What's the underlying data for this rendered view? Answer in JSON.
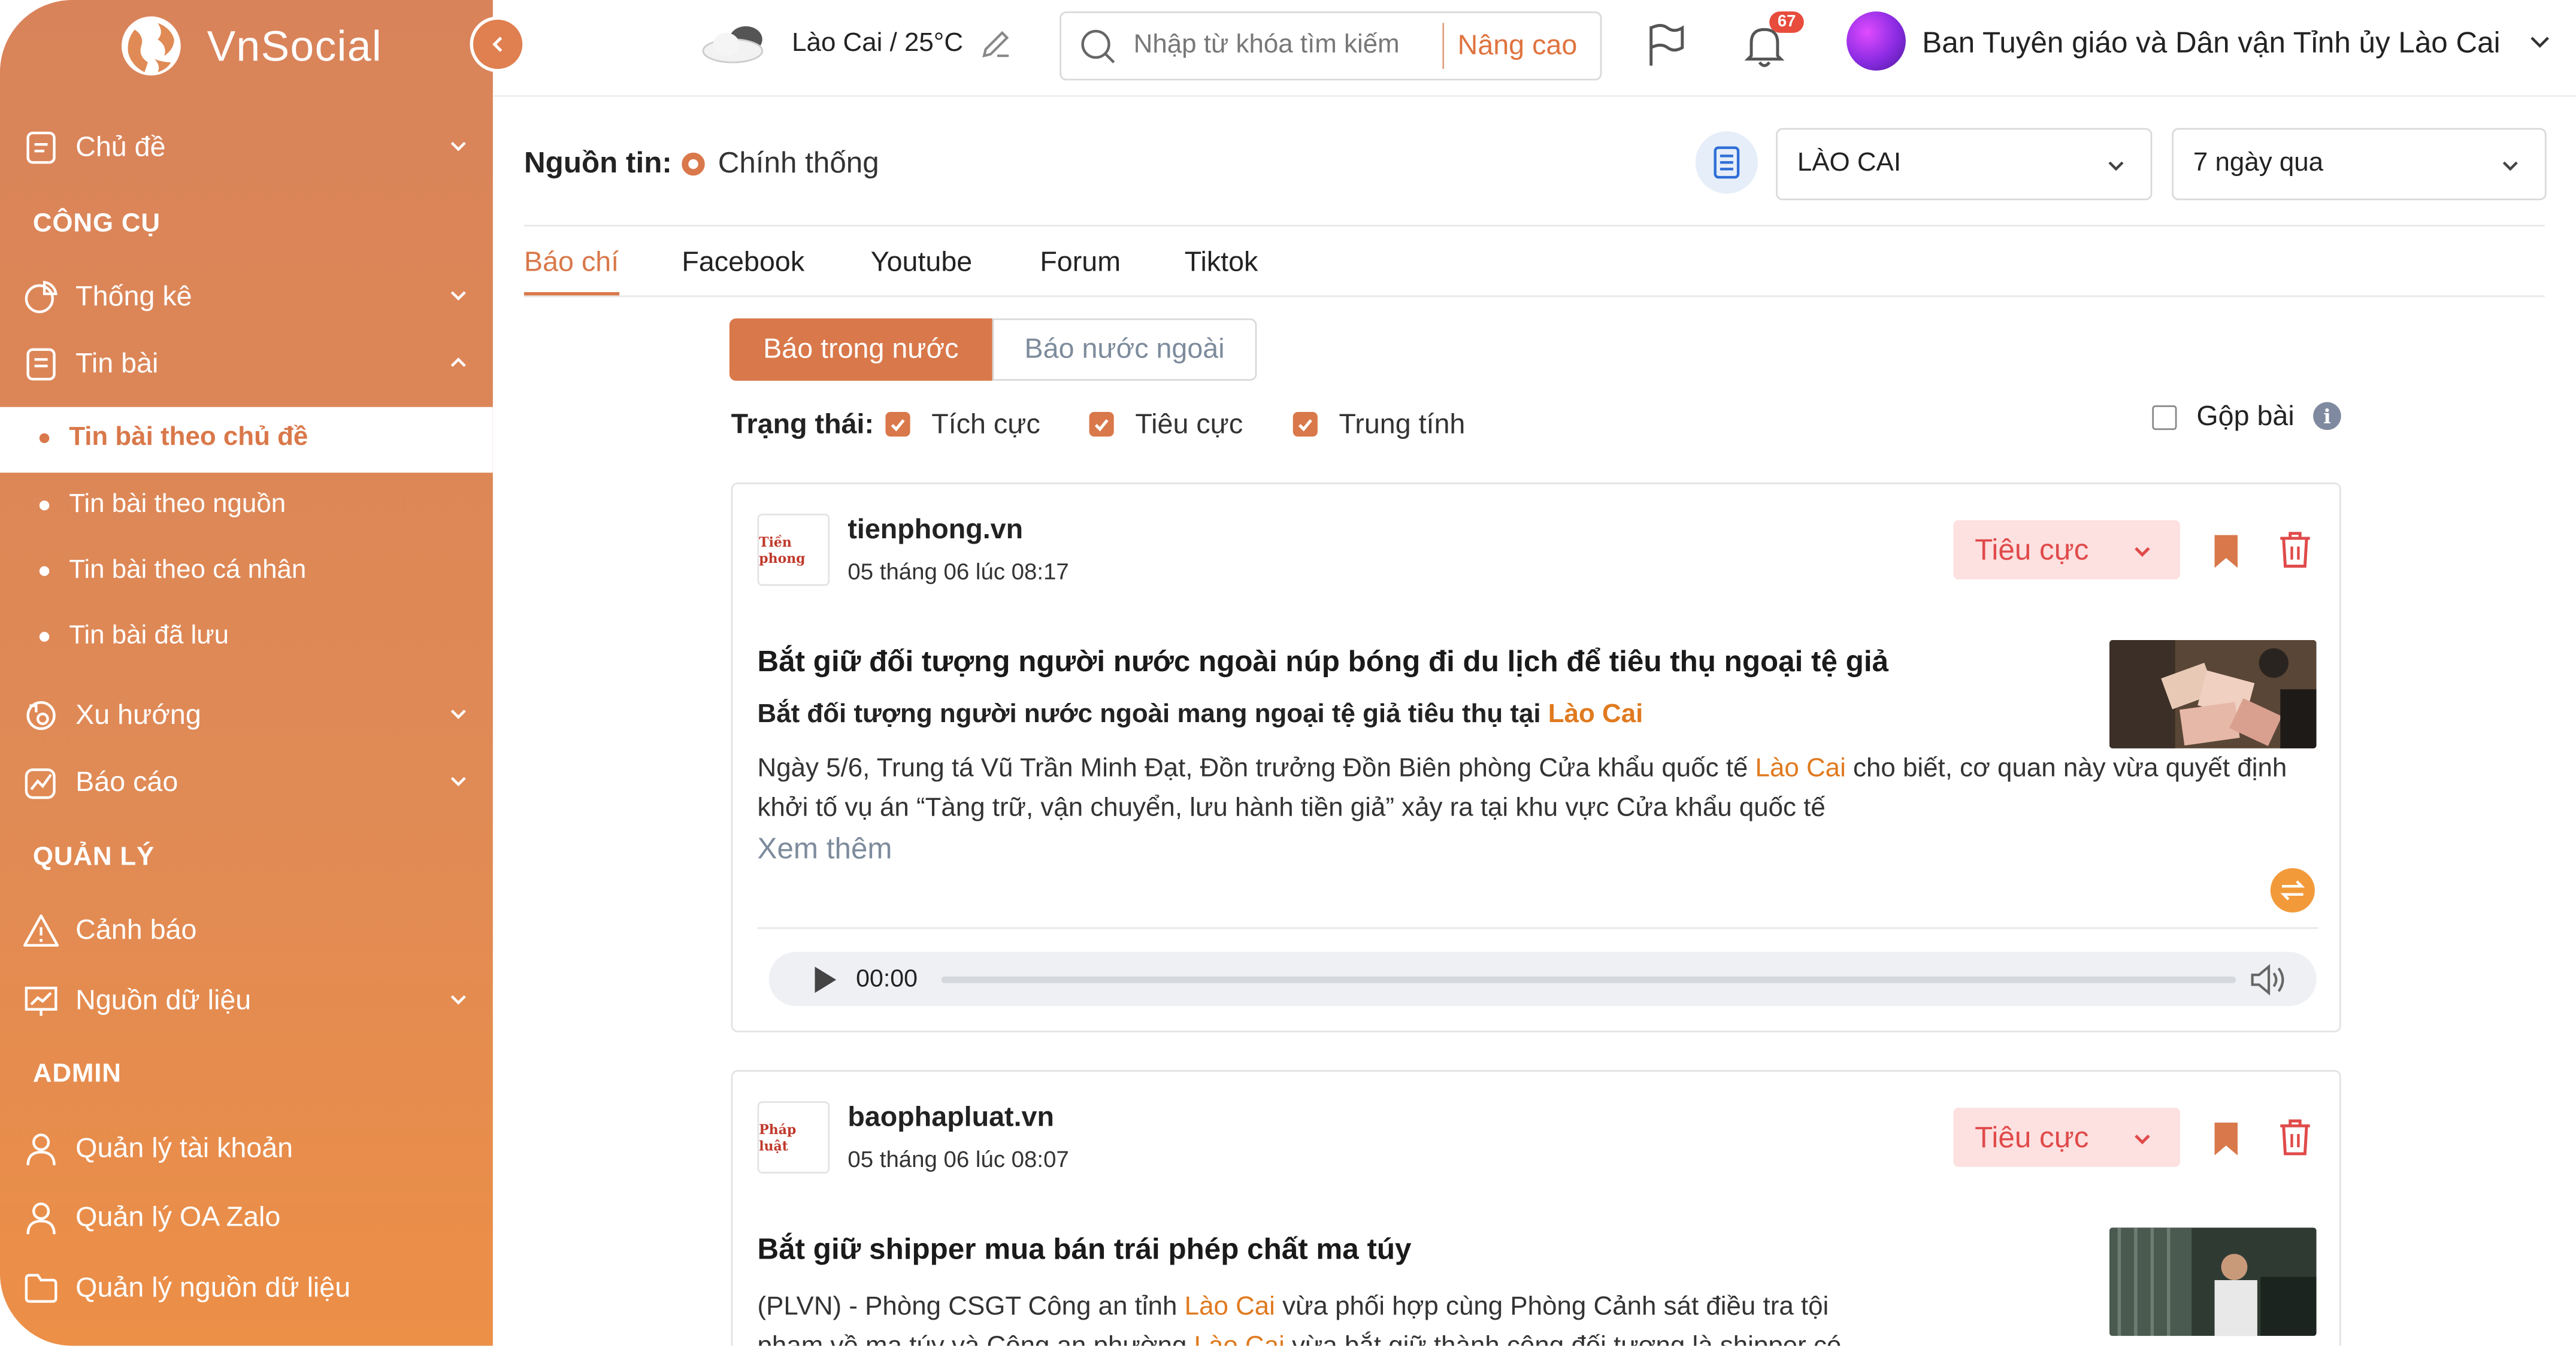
{
  "app": {
    "name": "VnSocial"
  },
  "sidebar": {
    "items": [
      {
        "label": "Chủ đề"
      },
      {
        "label": "Thống kê"
      },
      {
        "label": "Tin bài"
      },
      {
        "label": "Xu hướng"
      },
      {
        "label": "Báo cáo"
      },
      {
        "label": "Cảnh báo"
      },
      {
        "label": "Nguồn dữ liệu"
      },
      {
        "label": "Quản lý tài khoản"
      },
      {
        "label": "Quản lý OA Zalo"
      },
      {
        "label": "Quản lý nguồn dữ liệu"
      }
    ],
    "sections": {
      "tools": "CÔNG CỤ",
      "manage": "QUẢN LÝ",
      "admin": "ADMIN"
    },
    "submenu": [
      {
        "label": "Tin bài theo chủ đề"
      },
      {
        "label": "Tin bài theo nguồn"
      },
      {
        "label": "Tin bài theo cá nhân"
      },
      {
        "label": "Tin bài đã lưu"
      }
    ]
  },
  "header": {
    "weather": "Lào Cai / 25°C",
    "search_placeholder": "Nhập từ khóa tìm kiếm",
    "advanced": "Nâng cao",
    "notification_count": "67",
    "org": "Ban Tuyên giáo và Dân vận Tỉnh ủy Lào Cai"
  },
  "filters": {
    "source_label": "Nguồn tin:",
    "source_value": "Chính thống",
    "region": "LÀO CAI",
    "period": "7 ngày qua"
  },
  "tabs": [
    {
      "label": "Báo chí"
    },
    {
      "label": "Facebook"
    },
    {
      "label": "Youtube"
    },
    {
      "label": "Forum"
    },
    {
      "label": "Tiktok"
    }
  ],
  "segments": {
    "domestic": "Báo trong nước",
    "foreign": "Báo nước ngoài"
  },
  "status": {
    "label": "Trạng thái:",
    "positive": "Tích cực",
    "negative": "Tiêu cực",
    "neutral": "Trung tính",
    "merge": "Gộp bài"
  },
  "articles": [
    {
      "source": "tienphong.vn",
      "logo_text": "Tiền phong",
      "time": "05 tháng 06 lúc 08:17",
      "sentiment": "Tiêu cực",
      "title": "Bắt giữ đối tượng người nước ngoài núp bóng đi du lịch để tiêu thụ ngoại tệ giả",
      "subtitle_pre": "Bắt đối tượng người nước ngoài mang ngoại tệ giả tiêu thụ tại ",
      "subtitle_hl": "Lào Cai",
      "body_pre": "Ngày 5/6, Trung tá Vũ Trần Minh Đạt, Đồn trưởng Đồn Biên phòng Cửa khẩu quốc tế ",
      "body_hl": "Lào Cai",
      "body_post": " cho biết, cơ quan này vừa quyết định khởi tố vụ án “Tàng trữ, vận chuyển, lưu hành tiền giả” xảy ra tại khu vực Cửa khẩu quốc tế",
      "more": "Xem thêm",
      "audio_time": "00:00"
    },
    {
      "source": "baophapluat.vn",
      "logo_text": "Pháp luật",
      "time": "05 tháng 06 lúc 08:07",
      "sentiment": "Tiêu cực",
      "title": "Bắt giữ shipper mua bán trái phép chất ma túy",
      "body_pre": "(PLVN) - Phòng CSGT Công an tỉnh ",
      "body_hl": "Lào Cai",
      "body_mid": " vừa phối hợp cùng Phòng Cảnh sát điều tra tội phạm về ma túy và Công an phường ",
      "body_hl2": "Lào Cai",
      "body_post": " vừa bắt giữ thành công đối tượng là shipper có"
    }
  ],
  "colors": {
    "accent": "#d9784a",
    "negative_bg": "#fde0e0",
    "negative_text": "#e04a4a",
    "highlight": "#e07a1f"
  }
}
